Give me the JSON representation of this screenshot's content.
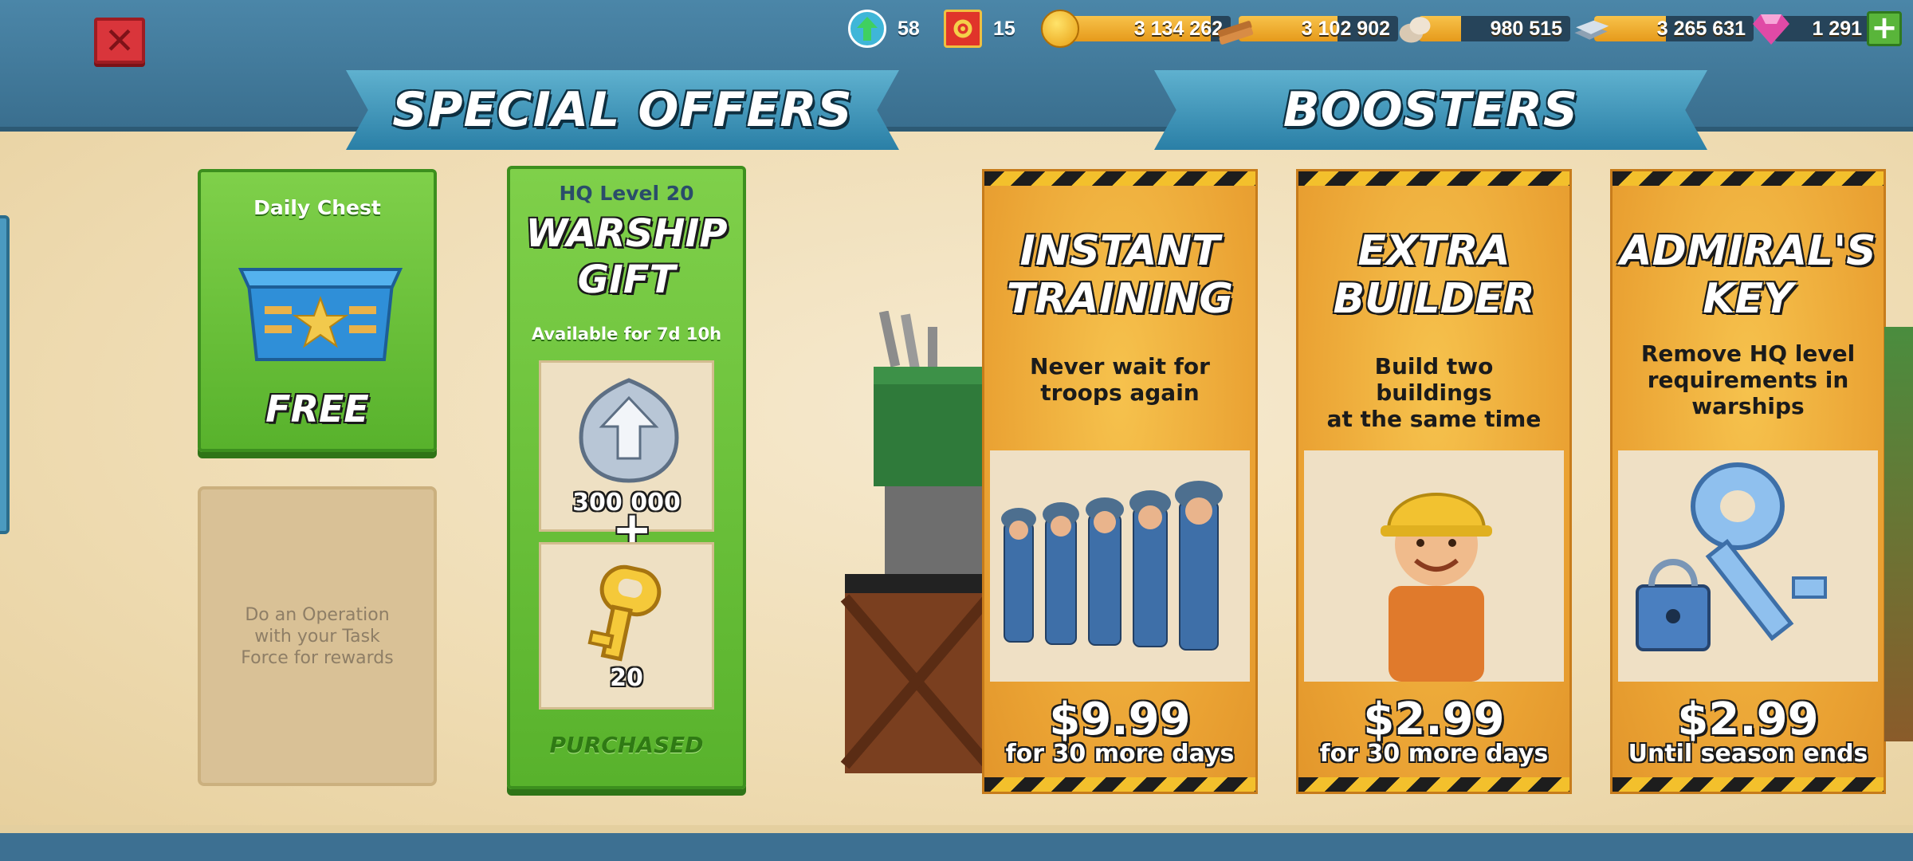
{
  "header": {
    "resources": [
      {
        "name": "intel",
        "icon": "intel-icon",
        "value": "58",
        "color": "#3fb6d8"
      },
      {
        "name": "parts",
        "icon": "gear-parts-icon",
        "value": "15",
        "color": "#e0342a"
      },
      {
        "name": "gold",
        "icon": "gold-coin-icon",
        "value": "3 134 262",
        "color": "#f5b81f",
        "fill": 0.88
      },
      {
        "name": "wood",
        "icon": "wood-icon",
        "value": "3 102 902",
        "color": "#c7803d",
        "fill": 0.62
      },
      {
        "name": "stone",
        "icon": "stone-icon",
        "value": "980 515",
        "color": "#c9b7a1",
        "fill": 0.28
      },
      {
        "name": "iron",
        "icon": "iron-icon",
        "value": "3 265 631",
        "color": "#b7c4d0",
        "fill": 0.45
      },
      {
        "name": "diamonds",
        "icon": "diamond-icon",
        "value": "1 291",
        "color": "#e04aa6"
      }
    ]
  },
  "banners": {
    "special_offers": "SPECIAL OFFERS",
    "boosters": "BOOSTERS"
  },
  "daily_chest": {
    "title": "Daily Chest",
    "label": "FREE"
  },
  "operation_card": {
    "text": "Do an Operation with your Task Force for rewards"
  },
  "warship_gift": {
    "hq_level": "HQ Level 20",
    "title_line1": "WARSHIP",
    "title_line2": "GIFT",
    "availability": "Available for 7d 10h",
    "reward1_value": "300 000",
    "reward2_value": "20",
    "status": "PURCHASED"
  },
  "boosters": [
    {
      "title_line1": "INSTANT",
      "title_line2": "TRAINING",
      "desc_line1": "Never wait for",
      "desc_line2": "troops again",
      "desc_line3": "",
      "price": "$9.99",
      "duration": "for 30 more days"
    },
    {
      "title_line1": "EXTRA",
      "title_line2": "BUILDER",
      "desc_line1": "Build two buildings",
      "desc_line2": "at the same time",
      "desc_line3": "",
      "price": "$2.99",
      "duration": "for 30 more days"
    },
    {
      "title_line1": "ADMIRAL'S",
      "title_line2": "KEY",
      "desc_line1": "Remove HQ level",
      "desc_line2": "requirements in",
      "desc_line3": "warships",
      "price": "$2.99",
      "duration": "Until season ends"
    }
  ]
}
